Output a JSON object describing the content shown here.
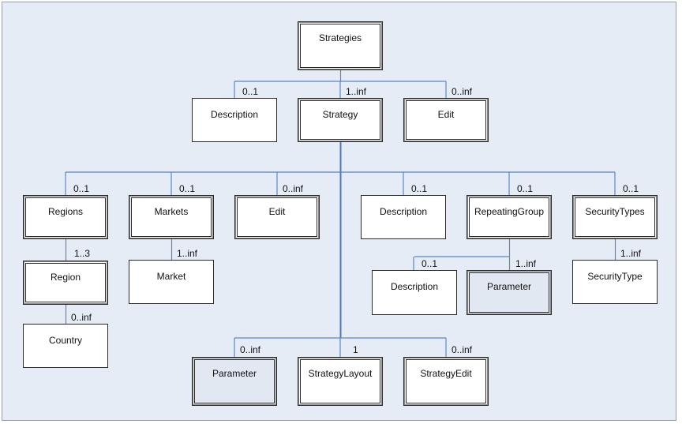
{
  "diagram": {
    "root": "Strategies",
    "nodes": [
      {
        "id": "strategies",
        "label": "Strategies",
        "kind": "complex"
      },
      {
        "id": "description-top",
        "label": "Description",
        "kind": "simple",
        "card": "0..1"
      },
      {
        "id": "strategy",
        "label": "Strategy",
        "kind": "complex",
        "card": "1..inf"
      },
      {
        "id": "edit-top",
        "label": "Edit",
        "kind": "complex",
        "card": "0..inf"
      },
      {
        "id": "regions",
        "label": "Regions",
        "kind": "complex",
        "card": "0..1"
      },
      {
        "id": "markets",
        "label": "Markets",
        "kind": "complex",
        "card": "0..1"
      },
      {
        "id": "edit-mid",
        "label": "Edit",
        "kind": "complex",
        "card": "0..inf"
      },
      {
        "id": "description-mid",
        "label": "Description",
        "kind": "simple",
        "card": "0..1"
      },
      {
        "id": "repeating-group",
        "label": "RepeatingGroup",
        "kind": "complex",
        "card": "0..1"
      },
      {
        "id": "security-types",
        "label": "SecurityTypes",
        "kind": "complex",
        "card": "0..1"
      },
      {
        "id": "region",
        "label": "Region",
        "kind": "complex",
        "card": "1..3"
      },
      {
        "id": "market",
        "label": "Market",
        "kind": "simple",
        "card": "1..inf"
      },
      {
        "id": "country",
        "label": "Country",
        "kind": "simple",
        "card": "0..inf"
      },
      {
        "id": "rg-description",
        "label": "Description",
        "kind": "simple",
        "card": "0..1"
      },
      {
        "id": "rg-parameter",
        "label": "Parameter",
        "kind": "complex-shaded",
        "card": "1..inf"
      },
      {
        "id": "security-type",
        "label": "SecurityType",
        "kind": "simple",
        "card": "1..inf"
      },
      {
        "id": "parameter",
        "label": "Parameter",
        "kind": "complex-shaded",
        "card": "0..inf"
      },
      {
        "id": "strategy-layout",
        "label": "StrategyLayout",
        "kind": "complex",
        "card": "1"
      },
      {
        "id": "strategy-edit",
        "label": "StrategyEdit",
        "kind": "complex",
        "card": "0..inf"
      }
    ],
    "edges": [
      {
        "from": "strategies",
        "to": "description-top"
      },
      {
        "from": "strategies",
        "to": "strategy"
      },
      {
        "from": "strategies",
        "to": "edit-top"
      },
      {
        "from": "strategy",
        "to": "regions"
      },
      {
        "from": "strategy",
        "to": "markets"
      },
      {
        "from": "strategy",
        "to": "edit-mid"
      },
      {
        "from": "strategy",
        "to": "description-mid"
      },
      {
        "from": "strategy",
        "to": "repeating-group"
      },
      {
        "from": "strategy",
        "to": "security-types"
      },
      {
        "from": "strategy",
        "to": "parameter"
      },
      {
        "from": "strategy",
        "to": "strategy-layout"
      },
      {
        "from": "strategy",
        "to": "strategy-edit"
      },
      {
        "from": "regions",
        "to": "region"
      },
      {
        "from": "region",
        "to": "country"
      },
      {
        "from": "markets",
        "to": "market"
      },
      {
        "from": "repeating-group",
        "to": "rg-description"
      },
      {
        "from": "repeating-group",
        "to": "rg-parameter"
      },
      {
        "from": "security-types",
        "to": "security-type"
      }
    ],
    "colors": {
      "background": "#e6ecf6",
      "connector": "#5b86c8",
      "connector_main": "#4a78c4",
      "shaded_fill": "#e2e8f2",
      "node_fill": "#ffffff"
    }
  }
}
